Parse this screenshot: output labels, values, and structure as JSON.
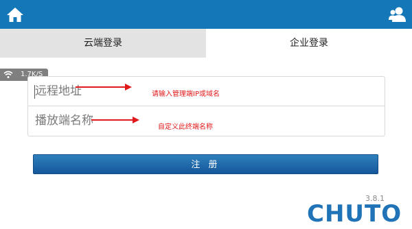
{
  "header": {
    "home_icon": "home-icon",
    "user_icon": "user-add-icon",
    "background_color": "#1377b8"
  },
  "tabs": [
    {
      "label": "云端登录",
      "active": false
    },
    {
      "label": "企业登录",
      "active": true
    }
  ],
  "status": {
    "wifi_icon": "wifi-icon",
    "speed": "1.7K/S"
  },
  "form": {
    "remote_address": {
      "placeholder": "远程地址",
      "value": ""
    },
    "player_name": {
      "placeholder": "播放端名称",
      "value": ""
    }
  },
  "annotations": {
    "remote_hint": "请输入管理端IP或域名",
    "player_hint": "自定义此终端名称",
    "color": "#e0191a"
  },
  "actions": {
    "register_label": "注 册"
  },
  "footer": {
    "version": "3.8.1",
    "brand": "CHUTO",
    "brand_color": "#1f73b6"
  }
}
